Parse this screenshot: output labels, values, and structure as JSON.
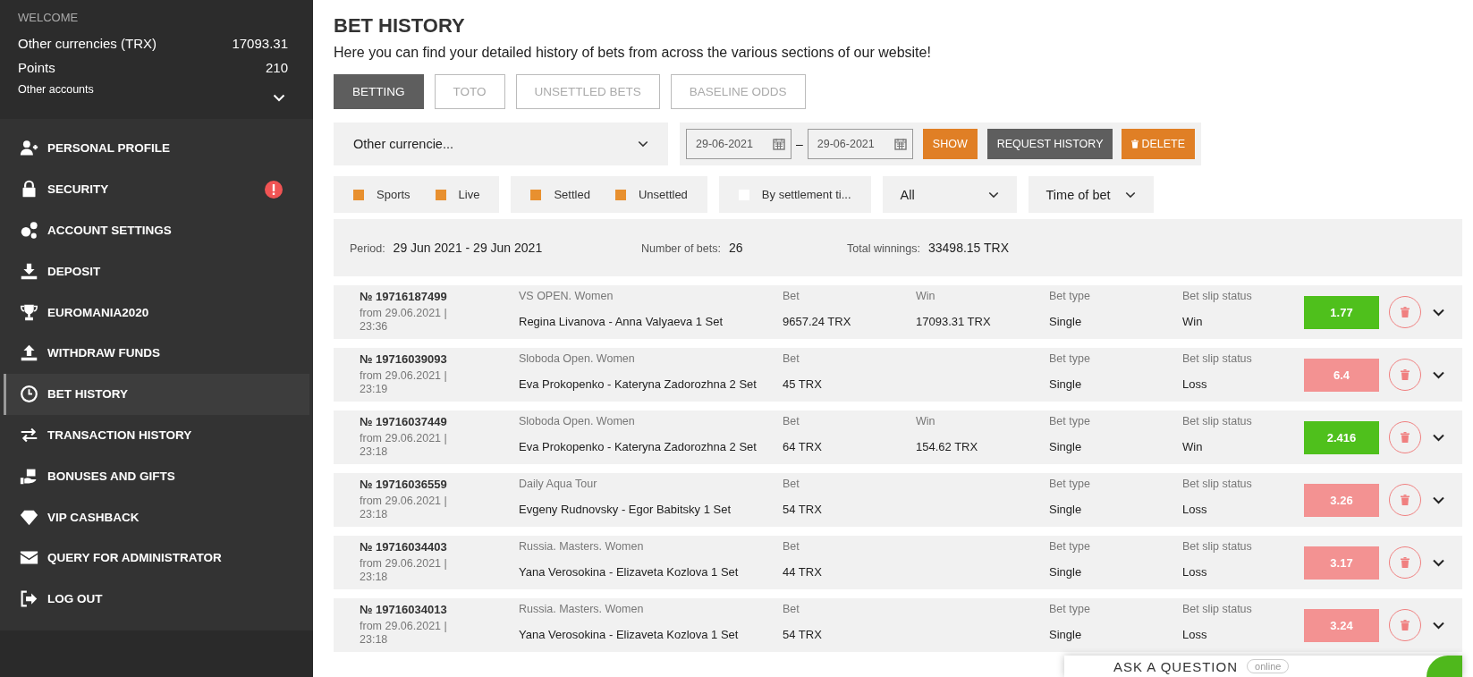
{
  "sidebar": {
    "welcome": "WELCOME",
    "balances": [
      {
        "label": "Other currencies (TRX)",
        "value": "17093.31"
      },
      {
        "label": "Points",
        "value": "210"
      }
    ],
    "other_accounts": {
      "label": "Other accounts",
      "expanded": false
    },
    "items": [
      {
        "label": "PERSONAL PROFILE",
        "selected": false,
        "alert": false
      },
      {
        "label": "SECURITY",
        "selected": false,
        "alert": true
      },
      {
        "label": "ACCOUNT SETTINGS",
        "selected": false,
        "alert": false
      },
      {
        "label": "DEPOSIT",
        "selected": false,
        "alert": false
      },
      {
        "label": "EUROMANIA2020",
        "selected": false,
        "alert": false
      },
      {
        "label": "WITHDRAW FUNDS",
        "selected": false,
        "alert": false
      },
      {
        "label": "BET HISTORY",
        "selected": true,
        "alert": false
      },
      {
        "label": "TRANSACTION HISTORY",
        "selected": false,
        "alert": false
      },
      {
        "label": "BONUSES AND GIFTS",
        "selected": false,
        "alert": false
      },
      {
        "label": "VIP CASHBACK",
        "selected": false,
        "alert": false
      },
      {
        "label": "QUERY FOR ADMINISTRATOR",
        "selected": false,
        "alert": false
      },
      {
        "label": "LOG OUT",
        "selected": false,
        "alert": false
      }
    ]
  },
  "page": {
    "title": "BET HISTORY",
    "subtitle": "Here you can find your detailed history of bets from across the various sections of our website!"
  },
  "tabs": [
    {
      "label": "BETTING",
      "selected": true
    },
    {
      "label": "TOTO",
      "selected": false
    },
    {
      "label": "UNSETTLED BETS",
      "selected": false
    },
    {
      "label": "BASELINE ODDS",
      "selected": false
    }
  ],
  "filters": {
    "currency": "Other currencie...",
    "date_from": "29-06-2021",
    "date_separator": "–",
    "date_to": "29-06-2021",
    "buttons": [
      {
        "label": "SHOW",
        "kind": "primary"
      },
      {
        "label": "REQUEST HISTORY",
        "kind": "secondary"
      },
      {
        "label": "DELETE",
        "kind": "delete"
      }
    ],
    "checkbox_groups": [
      [
        {
          "label": "Sports",
          "checked": true
        },
        {
          "label": "Live",
          "checked": true
        }
      ],
      [
        {
          "label": "Settled",
          "checked": true
        },
        {
          "label": "Unsettled",
          "checked": true
        }
      ],
      [
        {
          "label": "By settlement ti...",
          "checked": false
        }
      ]
    ],
    "selects": [
      "All",
      "Time of bet"
    ]
  },
  "summary": [
    {
      "label": "Period:",
      "value": "29 Jun 2021 - 29 Jun 2021"
    },
    {
      "label": "Number of bets:",
      "value": "26"
    },
    {
      "label": "Total winnings:",
      "value": "33498.15 TRX"
    }
  ],
  "bets": [
    {
      "number": "№ 19716187499",
      "date": "from 29.06.2021 | 23:36",
      "league": "VS OPEN. Women",
      "event": "Regina Livanova - Anna Valyaeva 1 Set",
      "bet_label": "Bet",
      "bet": "9657.24 TRX",
      "win_label": "Win",
      "win": "17093.31 TRX",
      "type_label": "Bet type",
      "type": "Single",
      "status_label": "Bet slip status",
      "status": "Win",
      "odds": "1.77",
      "color": "#4fc01c"
    },
    {
      "number": "№ 19716039093",
      "date": "from 29.06.2021 | 23:19",
      "league": "Sloboda Open. Women",
      "event": "Eva Prokopenko - Kateryna Zadorozhna 2 Set",
      "bet_label": "Bet",
      "bet": "45 TRX",
      "type_label": "Bet type",
      "type": "Single",
      "status_label": "Bet slip status",
      "status": "Loss",
      "odds": "6.4",
      "color": "#f39292"
    },
    {
      "number": "№ 19716037449",
      "date": "from 29.06.2021 | 23:18",
      "league": "Sloboda Open. Women",
      "event": "Eva Prokopenko - Kateryna Zadorozhna 2 Set",
      "bet_label": "Bet",
      "bet": "64 TRX",
      "win_label": "Win",
      "win": "154.62 TRX",
      "type_label": "Bet type",
      "type": "Single",
      "status_label": "Bet slip status",
      "status": "Win",
      "odds": "2.416",
      "color": "#4fc01c"
    },
    {
      "number": "№ 19716036559",
      "date": "from 29.06.2021 | 23:18",
      "league": "Daily Aqua Tour",
      "event": "Evgeny Rudnovsky - Egor Babitsky 1 Set",
      "bet_label": "Bet",
      "bet": "54 TRX",
      "type_label": "Bet type",
      "type": "Single",
      "status_label": "Bet slip status",
      "status": "Loss",
      "odds": "3.26",
      "color": "#f39292"
    },
    {
      "number": "№ 19716034403",
      "date": "from 29.06.2021 | 23:18",
      "league": "Russia. Masters. Women",
      "event": "Yana Verosokina - Elizaveta Kozlova 1 Set",
      "bet_label": "Bet",
      "bet": "44 TRX",
      "type_label": "Bet type",
      "type": "Single",
      "status_label": "Bet slip status",
      "status": "Loss",
      "odds": "3.17",
      "color": "#f39292"
    },
    {
      "number": "№ 19716034013",
      "date": "from 29.06.2021 | 23:18",
      "league": "Russia. Masters. Women",
      "event": "Yana Verosokina - Elizaveta Kozlova 1 Set",
      "bet_label": "Bet",
      "bet": "54 TRX",
      "type_label": "Bet type",
      "type": "Single",
      "status_label": "Bet slip status",
      "status": "Loss",
      "odds": "3.24",
      "color": "#f39292"
    }
  ],
  "chat": {
    "label": "ASK A QUESTION",
    "status": "online"
  }
}
